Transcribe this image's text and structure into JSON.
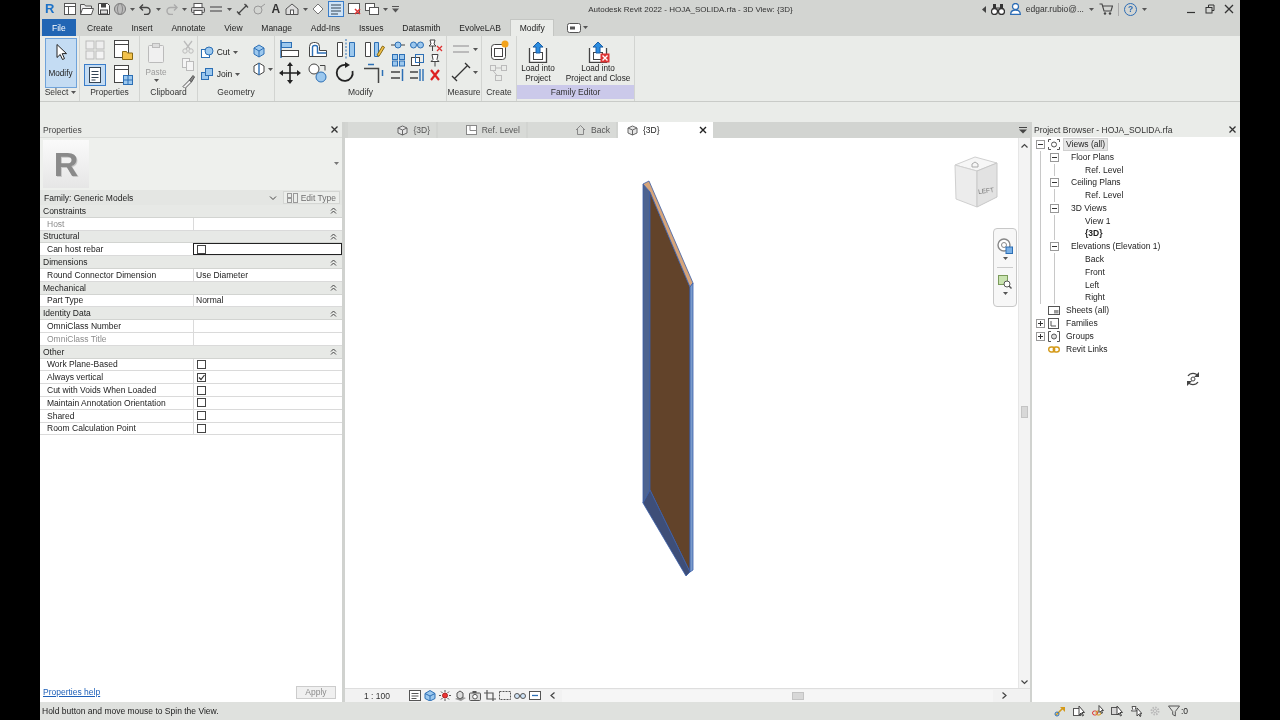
{
  "title_bar": {
    "logo": "R",
    "text_tool": "A",
    "thin_lines_on": true,
    "title": "Autodesk Revit 2022 - HOJA_SOLIDA.rfa - 3D View: {3D}",
    "user": "edgar.rubio@...",
    "help_button": "?"
  },
  "ribbon_tabs": [
    {
      "label": "File",
      "kind": "file",
      "selected": false
    },
    {
      "label": "Create",
      "kind": "tab",
      "selected": false
    },
    {
      "label": "Insert",
      "kind": "tab",
      "selected": false
    },
    {
      "label": "Annotate",
      "kind": "tab",
      "selected": false
    },
    {
      "label": "View",
      "kind": "tab",
      "selected": false
    },
    {
      "label": "Manage",
      "kind": "tab",
      "selected": false
    },
    {
      "label": "Add-Ins",
      "kind": "tab",
      "selected": false
    },
    {
      "label": "Issues",
      "kind": "tab",
      "selected": false
    },
    {
      "label": "Datasmith",
      "kind": "tab",
      "selected": false
    },
    {
      "label": "EvolveLAB",
      "kind": "tab",
      "selected": false
    },
    {
      "label": "Modify",
      "kind": "tab",
      "selected": true
    }
  ],
  "ribbon_panels": [
    {
      "kind": "select",
      "label": "Select",
      "buttons": [
        {
          "label": "Modify",
          "selected": true
        }
      ]
    },
    {
      "kind": "properties",
      "label": "Properties",
      "toggle_on": true
    },
    {
      "kind": "clipboard",
      "label": "Clipboard",
      "buttons": [
        {
          "label": "Paste",
          "disabled": true
        }
      ]
    },
    {
      "kind": "geometry",
      "label": "Geometry",
      "buttons": [
        {
          "label": "Cut"
        },
        {
          "label": "Join"
        }
      ]
    },
    {
      "kind": "modify",
      "label": "Modify"
    },
    {
      "kind": "measure",
      "label": "Measure"
    },
    {
      "kind": "create",
      "label": "Create"
    },
    {
      "kind": "family_editor",
      "label": "Family Editor",
      "buttons": [
        {
          "label": "Load into Project"
        },
        {
          "label": "Load into\nProject and Close"
        }
      ]
    }
  ],
  "properties": {
    "title": "Properties",
    "type_image": "R",
    "type_selector": "Family: Generic Models",
    "edit_type": {
      "label": "Edit Type",
      "disabled": true
    },
    "groups": [
      {
        "label": "Constraints",
        "expanded": true,
        "rows": [
          {
            "label": "Host",
            "kind": "text",
            "disabled": true,
            "selected": false
          }
        ]
      },
      {
        "label": "Structural",
        "expanded": true,
        "rows": [
          {
            "label": "Can host rebar",
            "kind": "checkbox",
            "checked": false,
            "disabled": false,
            "selected": true
          }
        ]
      },
      {
        "label": "Dimensions",
        "expanded": true,
        "rows": [
          {
            "label": "Round Connector Dimension",
            "kind": "text",
            "value": "Use Diameter",
            "disabled": false,
            "selected": false
          }
        ]
      },
      {
        "label": "Mechanical",
        "expanded": true,
        "rows": [
          {
            "label": "Part Type",
            "kind": "text",
            "value": "Normal",
            "disabled": false,
            "selected": false
          }
        ]
      },
      {
        "label": "Identity Data",
        "expanded": true,
        "rows": [
          {
            "label": "OmniClass Number",
            "kind": "text",
            "disabled": false,
            "selected": false
          },
          {
            "label": "OmniClass Title",
            "kind": "text",
            "disabled": true,
            "selected": false
          }
        ]
      },
      {
        "label": "Other",
        "expanded": true,
        "rows": [
          {
            "label": "Work Plane-Based",
            "kind": "checkbox",
            "checked": false,
            "disabled": false,
            "selected": false
          },
          {
            "label": "Always vertical",
            "kind": "checkbox",
            "checked": true,
            "disabled": false,
            "selected": false
          },
          {
            "label": "Cut with Voids When Loaded",
            "kind": "checkbox",
            "checked": false,
            "disabled": false,
            "selected": false
          },
          {
            "label": "Maintain Annotation Orientation",
            "kind": "checkbox",
            "checked": false,
            "disabled": false,
            "selected": false
          },
          {
            "label": "Shared",
            "kind": "checkbox",
            "checked": false,
            "disabled": false,
            "selected": false
          },
          {
            "label": "Room Calculation Point",
            "kind": "checkbox",
            "checked": false,
            "disabled": false,
            "selected": false
          }
        ]
      }
    ],
    "help_link": "Properties help",
    "apply": {
      "label": "Apply",
      "disabled": true
    }
  },
  "view": {
    "tabs": [
      {
        "label": "{3D}",
        "kind": "model",
        "selected": false
      },
      {
        "label": "Ref. Level",
        "kind": "plan",
        "selected": false
      },
      {
        "label": "Back",
        "kind": "elevation",
        "selected": false
      },
      {
        "label": "{3D}",
        "kind": "model",
        "selected": true
      }
    ],
    "view_cube_face": "LEFT",
    "scale": "1 : 100"
  },
  "project_browser": {
    "title": "Project Browser - HOJA_SOLIDA.rfa",
    "tree": [
      {
        "label": "Views (all)",
        "kind": "views",
        "expanded": true,
        "selected": true,
        "children": [
          {
            "label": "Floor Plans",
            "expanded": true,
            "selected": false,
            "children": [
              {
                "label": "Ref. Level",
                "selected": false,
                "current": false
              }
            ]
          },
          {
            "label": "Ceiling Plans",
            "expanded": true,
            "selected": false,
            "children": [
              {
                "label": "Ref. Level",
                "selected": false,
                "current": false
              }
            ]
          },
          {
            "label": "3D Views",
            "expanded": true,
            "selected": false,
            "children": [
              {
                "label": "View 1",
                "selected": false,
                "current": false
              },
              {
                "label": "{3D}",
                "selected": false,
                "current": true
              }
            ]
          },
          {
            "label": "Elevations (Elevation 1)",
            "expanded": true,
            "selected": false,
            "children": [
              {
                "label": "Back",
                "selected": false,
                "current": false
              },
              {
                "label": "Front",
                "selected": false,
                "current": false
              },
              {
                "label": "Left",
                "selected": false,
                "current": false
              },
              {
                "label": "Right",
                "selected": false,
                "current": false
              }
            ]
          }
        ]
      },
      {
        "label": "Sheets (all)",
        "kind": "sheets",
        "selected": false
      },
      {
        "label": "Families",
        "kind": "families",
        "expanded": false,
        "selected": false
      },
      {
        "label": "Groups",
        "kind": "groups",
        "expanded": false,
        "selected": false
      },
      {
        "label": "Revit Links",
        "kind": "links",
        "selected": false
      }
    ]
  },
  "status_bar": {
    "message": "Hold button and move mouse to Spin the View.",
    "filter_count": ":0"
  }
}
